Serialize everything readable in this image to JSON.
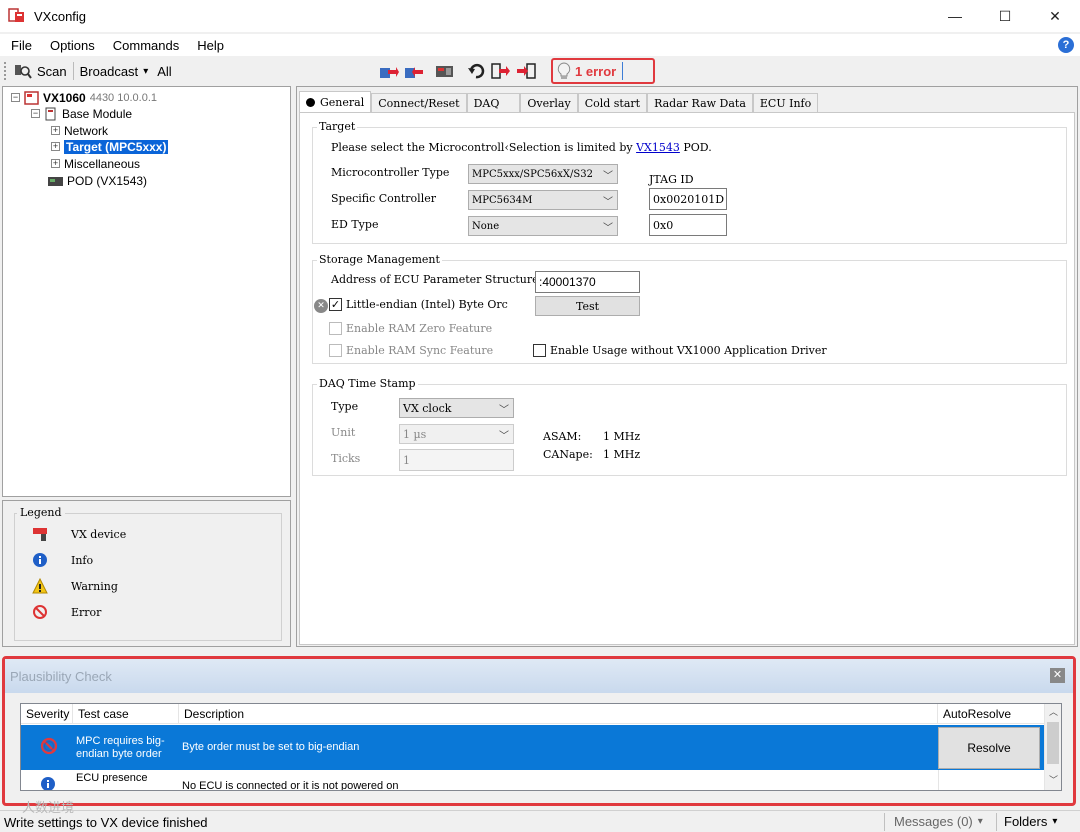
{
  "window": {
    "title": "VXconfig",
    "minimize": "—",
    "maximize": "☐",
    "close": "✕"
  },
  "menu": {
    "items": [
      "File",
      "Options",
      "Commands",
      "Help"
    ]
  },
  "toolbar": {
    "scan": "Scan",
    "broadcast": "Broadcast",
    "broadcast_arrow": "▾",
    "all": "All",
    "error_label": "1 error"
  },
  "tree": {
    "device": "VX1060",
    "device_meta": "4430  10.0.0.1",
    "base_module": "Base Module",
    "network": "Network",
    "target": "Target (MPC5xxx)",
    "misc": "Miscellaneous",
    "pod": "POD (VX1543)"
  },
  "legend": {
    "title": "Legend",
    "items": [
      {
        "icon": "vx-device-icon",
        "label": "VX device"
      },
      {
        "icon": "info-icon",
        "label": "Info"
      },
      {
        "icon": "warning-icon",
        "label": "Warning"
      },
      {
        "icon": "error-icon",
        "label": "Error"
      }
    ]
  },
  "tabs": [
    "General",
    "Connect/Reset",
    "DAQ",
    "Overlay",
    "Cold start",
    "Radar Raw Data",
    "ECU Info"
  ],
  "target": {
    "title": "Target",
    "info_prefix": "Please select the Microcontroll‹Selection is limited by",
    "info_link": "VX1543",
    "info_suffix": "POD.",
    "mc_type_label": "Microcontroller Type",
    "mc_type_value": "MPC5xxx/SPC56xX/S32",
    "specific_label": "Specific Controller",
    "specific_value": "MPC5634M",
    "ed_label": "ED Type",
    "ed_value": "None",
    "jtag_label": "JTAG ID",
    "jtag_value": "0x0020101D",
    "ed_id_value": "0x0"
  },
  "storage": {
    "title": "Storage Management",
    "address_label": "Address of ECU Parameter Structure",
    "address_value": ":40001370",
    "little_endian_label": "Little-endian (Intel) Byte Orc",
    "test_button": "Test",
    "ram_zero_label": "Enable RAM Zero Feature",
    "ram_sync_label": "Enable RAM Sync Feature",
    "enable_usage_label": "Enable Usage without VX1000 Application Driver"
  },
  "daq": {
    "title": "DAQ Time Stamp",
    "type_label": "Type",
    "type_value": "VX clock",
    "unit_label": "Unit",
    "unit_value": "1 µs",
    "ticks_label": "Ticks",
    "ticks_value": "1",
    "asam_label": "ASAM:",
    "asam_value": "1 MHz",
    "canape_label": "CANape:",
    "canape_value": "1 MHz"
  },
  "plausibility": {
    "title": "Plausibility Check",
    "columns": [
      "Severity",
      "Test case",
      "Description",
      "AutoResolve"
    ],
    "rows": [
      {
        "test_case": "MPC requires big-endian byte order",
        "description": "Byte order must be set to big-endian",
        "action": "Resolve"
      },
      {
        "test_case": "ECU presence check",
        "description": "No ECU is connected or it is not powered on"
      }
    ]
  },
  "status": {
    "text": "Write settings to VX device finished",
    "messages": "Messages (0)",
    "messages_arrow": "▾",
    "folders": "Folders",
    "folders_arrow": "▾"
  },
  "watermark": "人数进境",
  "colors": {
    "accent": "#0a78d7",
    "error": "#e0393e",
    "selection": "#0a64d8"
  }
}
